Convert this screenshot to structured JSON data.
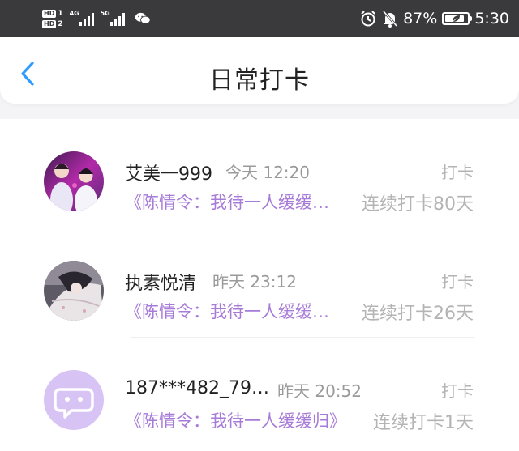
{
  "status_bar": {
    "hd1": "HD",
    "hd1_num": "1",
    "hd2": "HD",
    "hd2_num": "2",
    "net1": "4G",
    "net2": "5G",
    "battery_percent": "87%",
    "battery_level": 0.87,
    "time": "5:30",
    "icons": [
      "wechat-icon",
      "alarm-icon",
      "mute-bell-icon",
      "battery-icon"
    ]
  },
  "nav": {
    "title": "日常打卡",
    "back_icon": "chevron-left-icon"
  },
  "accent_color": "#2f9bff",
  "book_color": "#a77bd8",
  "items": [
    {
      "name": "艾美一999",
      "time": "今天 12:20",
      "action": "打卡",
      "book": "《陈情令：我待一人缓缓…",
      "streak": "连续打卡80天",
      "avatar": "photo-avatar-couple"
    },
    {
      "name": "执素悦清",
      "time": "昨天 23:12",
      "action": "打卡",
      "book": "《陈情令：我待一人缓缓…",
      "streak": "连续打卡26天",
      "avatar": "illustration-avatar"
    },
    {
      "name": "187***482_79…",
      "time": "昨天 20:52",
      "action": "打卡",
      "book": "《陈情令：我待一人缓缓归》",
      "streak": "连续打卡1天",
      "avatar": "default-chat-avatar"
    }
  ]
}
